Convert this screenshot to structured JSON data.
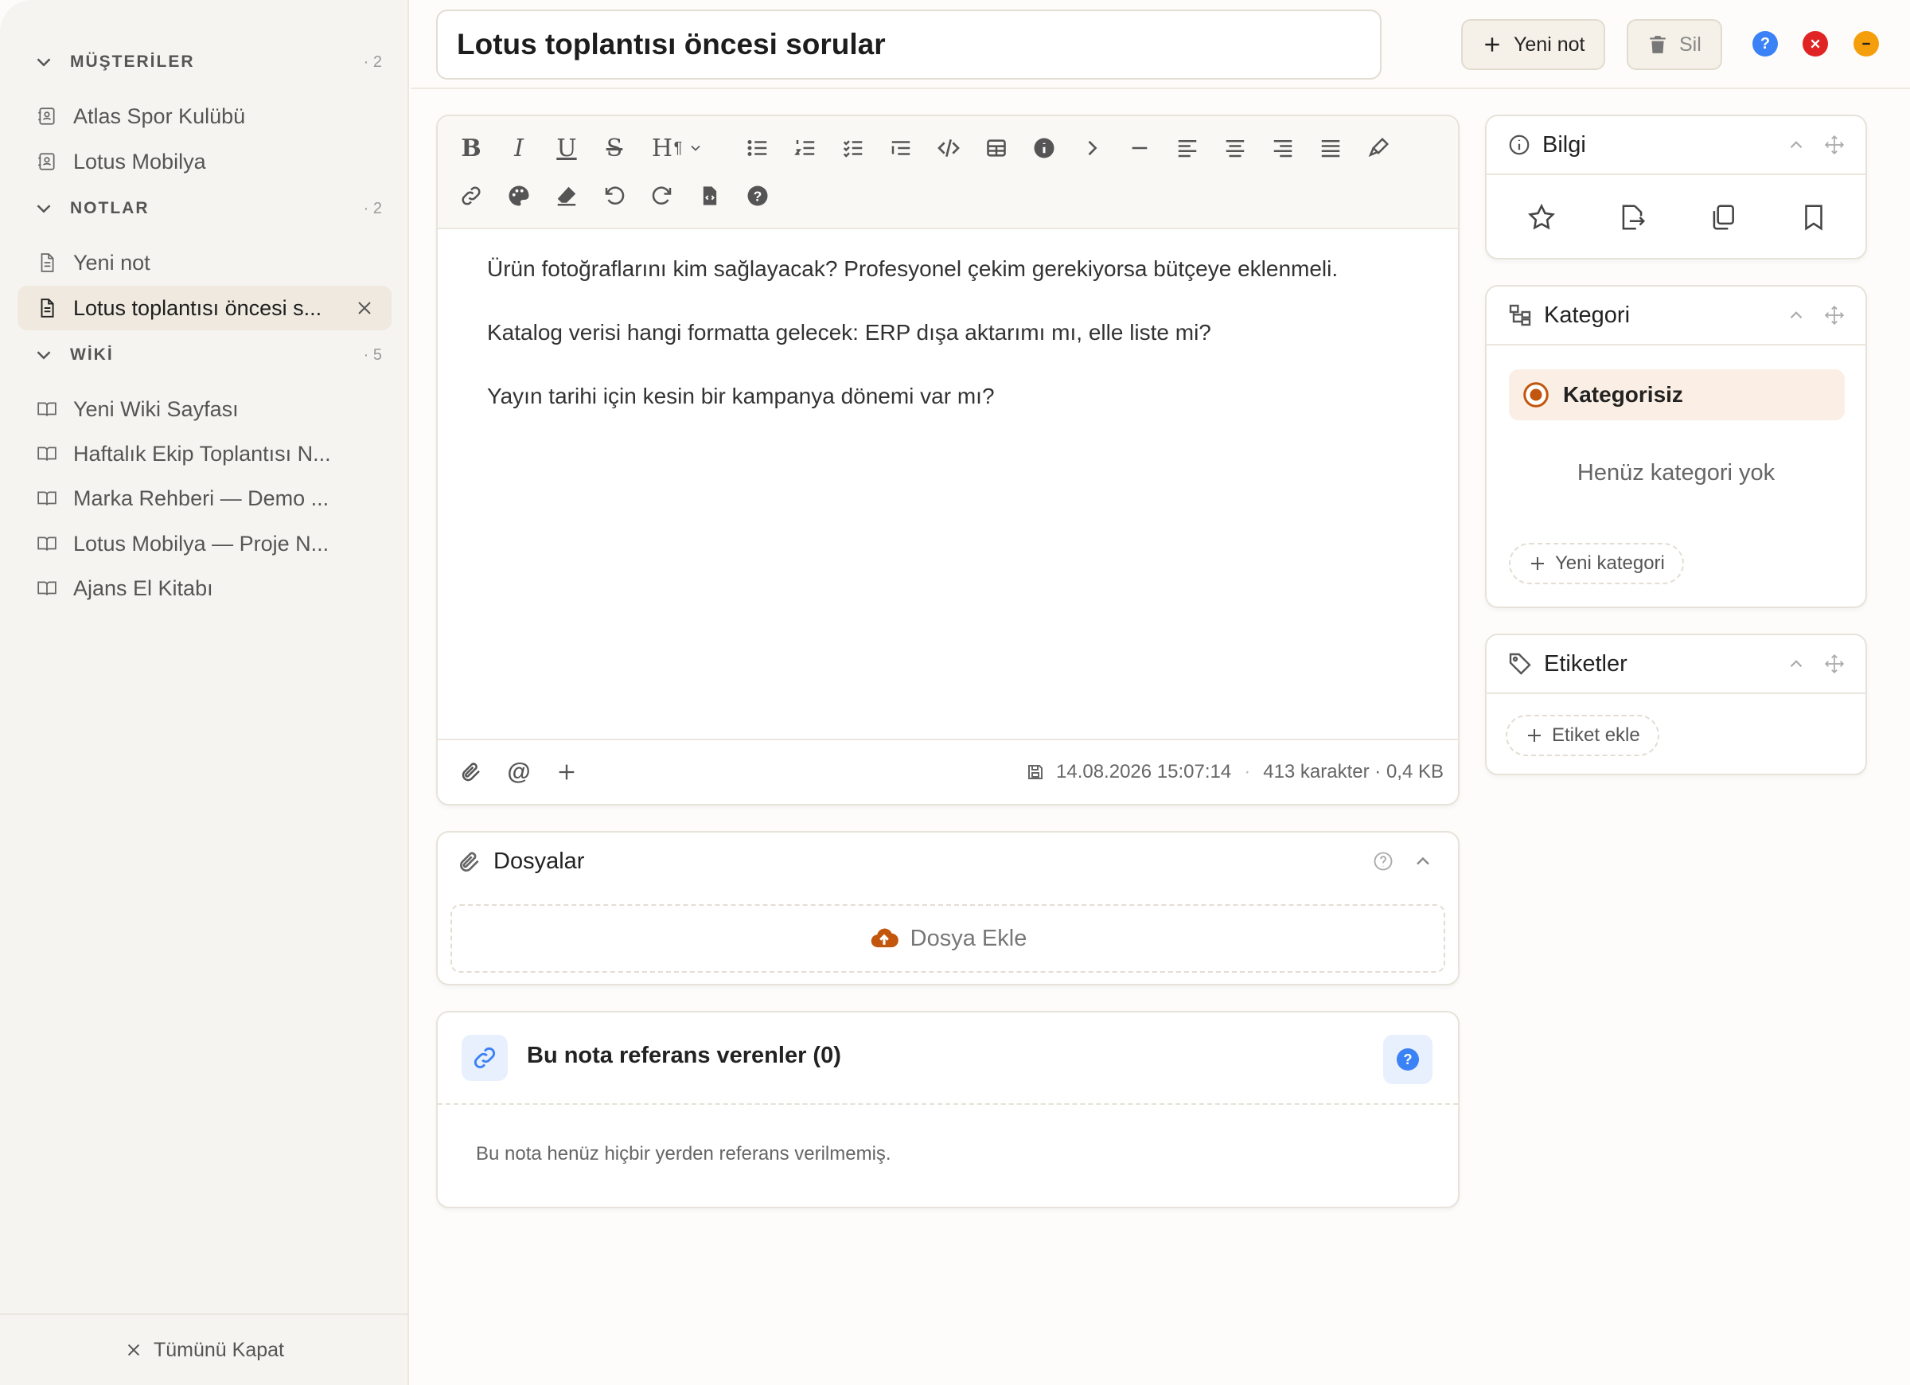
{
  "sidebar": {
    "sections": [
      {
        "title": "MÜŞTERİLER",
        "count": "· 2"
      },
      {
        "title": "NOTLAR",
        "count": "· 2"
      },
      {
        "title": "WİKİ",
        "count": "· 5"
      }
    ],
    "customers": [
      "Atlas Spor Kulübü",
      "Lotus Mobilya"
    ],
    "notes": [
      "Yeni not",
      "Lotus toplantısı öncesi s..."
    ],
    "wiki": [
      "Yeni Wiki Sayfası",
      "Haftalık Ekip Toplantısı N...",
      "Marka Rehberi — Demo ...",
      "Lotus Mobilya — Proje N...",
      "Ajans El Kitabı"
    ],
    "close_all": "Tümünü Kapat"
  },
  "header": {
    "title": "Lotus toplantısı öncesi sorular",
    "new_note": "Yeni not",
    "delete": "Sil",
    "colors": {
      "help": "#3b82f6",
      "close": "#e02424",
      "minimize": "#f59e0b"
    }
  },
  "editor": {
    "paragraphs": [
      "Ürün fotoğraflarını kim sağlayacak? Profesyonel çekim gerekiyorsa bütçeye eklenmeli.",
      "Katalog verisi hangi formatta gelecek: ERP dışa aktarımı mı, elle liste mi?",
      "Yayın tarihi için kesin bir kampanya dönemi var mı?"
    ],
    "saved_at": "14.08.2026 15:07:14",
    "stats": "413 karakter · 0,4 KB",
    "toolbar_icons": [
      "bold",
      "italic",
      "underline",
      "strikethrough",
      "heading",
      "paragraph",
      "bullet-list",
      "ordered-list",
      "task-list",
      "indent-list",
      "code",
      "table",
      "info",
      "chevron-right",
      "horizontal-rule",
      "align-left",
      "align-center",
      "align-right",
      "align-justify",
      "highlight",
      "link",
      "palette",
      "eraser",
      "undo",
      "redo",
      "source-file",
      "help"
    ]
  },
  "files": {
    "title": "Dosyalar",
    "add": "Dosya Ekle"
  },
  "references": {
    "title": "Bu nota referans verenler (0)",
    "empty": "Bu nota henüz hiçbir yerden referans verilmemiş."
  },
  "panels": {
    "info": {
      "title": "Bilgi"
    },
    "category": {
      "title": "Kategori",
      "selected": "Kategorisiz",
      "empty": "Henüz kategori yok",
      "new": "Yeni kategori"
    },
    "tags": {
      "title": "Etiketler",
      "add": "Etiket ekle"
    }
  },
  "accent": "#c2560c"
}
